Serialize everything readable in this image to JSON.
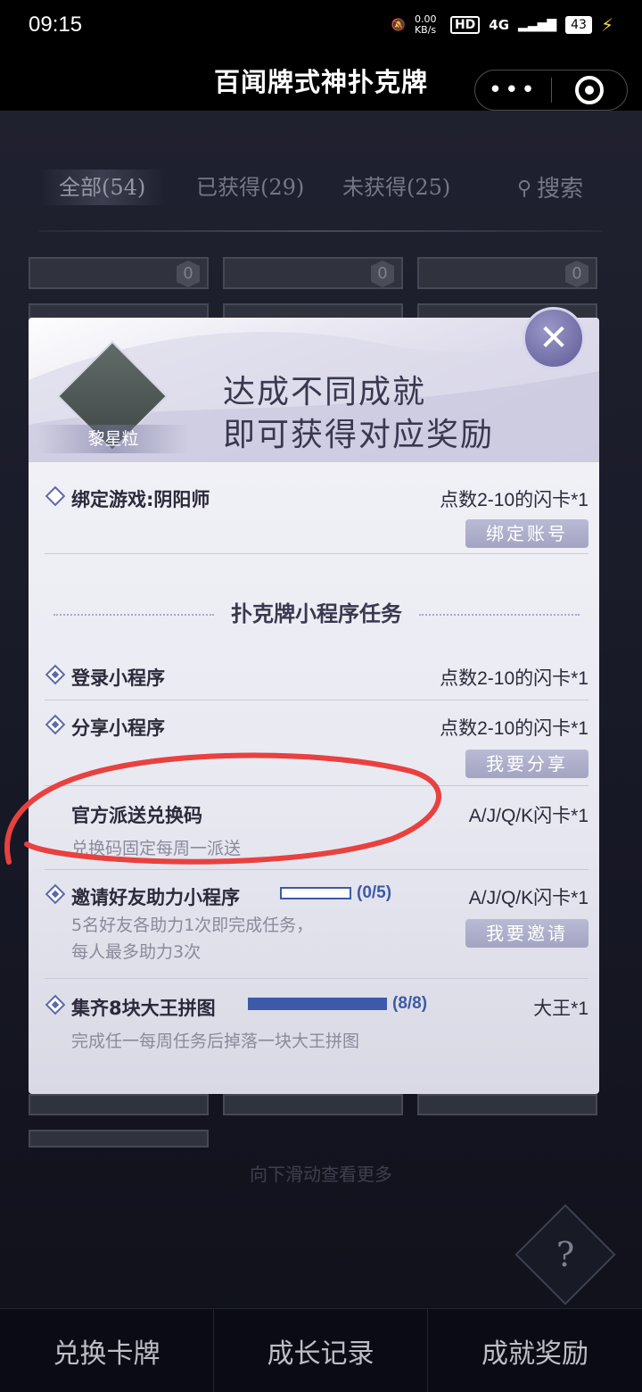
{
  "status_bar": {
    "time": "09:15",
    "speed": "0.00 KB/s",
    "hd_label": "HD",
    "network": "4G",
    "battery": "43"
  },
  "nav": {
    "title": "百闻牌式神扑克牌",
    "more_icon": "more-dots-icon",
    "target_icon": "target-icon"
  },
  "tabs": {
    "all": "全部(54)",
    "obtained": "已获得(29)",
    "not_obtained": "未获得(25)",
    "search": "搜索",
    "search_icon": "search-icon"
  },
  "card_badge_value": "0",
  "modal": {
    "item_name": "黎星粒",
    "header_line1": "达成不同成就",
    "header_line2": "即可获得对应奖励",
    "close_icon": "close-icon",
    "rows": [
      {
        "title": "绑定游戏:阴阳师",
        "reward": "点数2-10的闪卡*1",
        "button": "绑定账号"
      },
      {
        "title": "登录小程序",
        "reward": "点数2-10的闪卡*1"
      },
      {
        "title": "分享小程序",
        "reward": "点数2-10的闪卡*1",
        "button": "我要分享"
      },
      {
        "title": "官方派送兑换码",
        "reward": "A/J/Q/K闪卡*1",
        "desc": "兑换码固定每周一派送"
      },
      {
        "title": "邀请好友助力小程序",
        "reward": "A/J/Q/K闪卡*1",
        "progress_text": "(0/5)",
        "progress": 0.0,
        "desc1": "5名好友各助力1次即完成任务，",
        "desc2": "每人最多助力3次",
        "button": "我要邀请"
      },
      {
        "title": "集齐8块大王拼图",
        "reward": "大王*1",
        "progress_text": "(8/8)",
        "progress": 1.0,
        "desc": "完成任一每周任务后掉落一块大王拼图"
      }
    ],
    "section_title": "扑克牌小程序任务"
  },
  "scroll_hint": "向下滑动查看更多",
  "help_label": "?",
  "bottom_nav": {
    "redeem": "兑换卡牌",
    "growth": "成长记录",
    "achievement": "成就奖励"
  },
  "colors": {
    "accent_blue": "#3c5aa8",
    "annotation_red": "#e8413f"
  }
}
